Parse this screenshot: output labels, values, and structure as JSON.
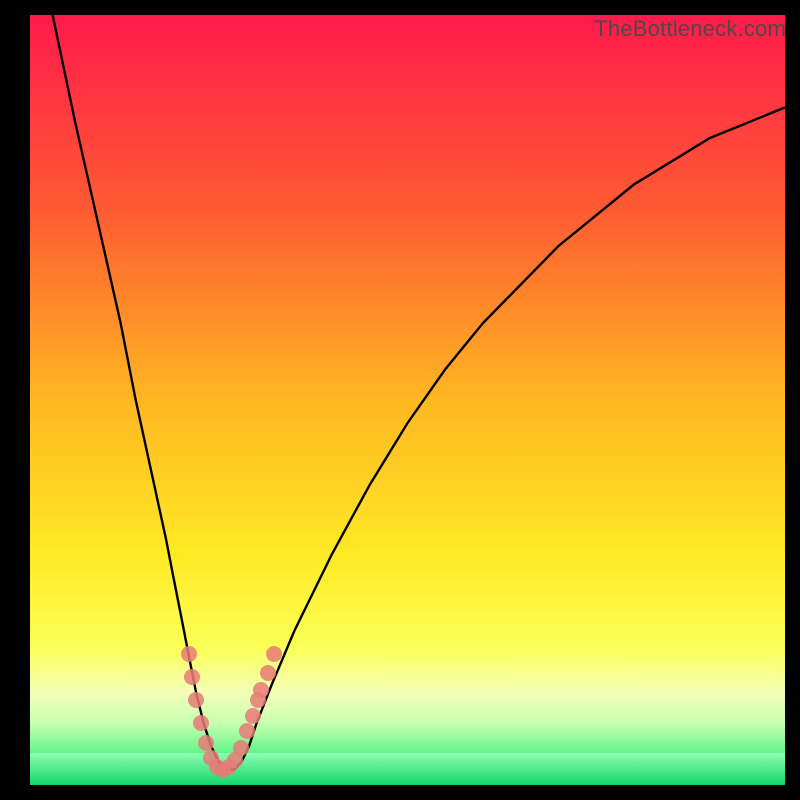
{
  "watermark": "TheBottleneck.com",
  "chart_data": {
    "type": "line",
    "title": "",
    "xlabel": "",
    "ylabel": "",
    "xlim": [
      0,
      100
    ],
    "ylim": [
      0,
      100
    ],
    "series": [
      {
        "name": "bottleneck-curve",
        "x": [
          3,
          6,
          9,
          12,
          14,
          16,
          18,
          19,
          20,
          21,
          22,
          23,
          24,
          25,
          26,
          27,
          28,
          29,
          30,
          32,
          35,
          40,
          45,
          50,
          55,
          60,
          65,
          70,
          75,
          80,
          85,
          90,
          95,
          100
        ],
        "y": [
          100,
          86,
          73,
          60,
          50,
          41,
          32,
          27,
          22,
          17,
          12,
          8,
          5,
          3,
          2,
          2,
          3,
          5,
          8,
          13,
          20,
          30,
          39,
          47,
          54,
          60,
          65,
          70,
          74,
          78,
          81,
          84,
          86,
          88
        ]
      }
    ],
    "markers": {
      "name": "highlight-points",
      "color": "#e77a78",
      "points": [
        {
          "x": 21.0,
          "y": 17
        },
        {
          "x": 21.5,
          "y": 14
        },
        {
          "x": 22.0,
          "y": 11
        },
        {
          "x": 22.7,
          "y": 8
        },
        {
          "x": 23.3,
          "y": 5.5
        },
        {
          "x": 24.0,
          "y": 3.5
        },
        {
          "x": 24.8,
          "y": 2.3
        },
        {
          "x": 25.6,
          "y": 2.0
        },
        {
          "x": 26.4,
          "y": 2.3
        },
        {
          "x": 27.2,
          "y": 3.3
        },
        {
          "x": 28.0,
          "y": 4.8
        },
        {
          "x": 28.8,
          "y": 7.0
        },
        {
          "x": 29.5,
          "y": 9.0
        },
        {
          "x": 30.2,
          "y": 11.0
        },
        {
          "x": 30.6,
          "y": 12.3
        },
        {
          "x": 31.5,
          "y": 14.5
        },
        {
          "x": 32.3,
          "y": 17.0
        }
      ]
    },
    "gradient": {
      "stops": [
        {
          "pos": 0,
          "color": "#ff1a4b"
        },
        {
          "pos": 25,
          "color": "#ff5a33"
        },
        {
          "pos": 50,
          "color": "#ffb722"
        },
        {
          "pos": 70,
          "color": "#ffe924"
        },
        {
          "pos": 82,
          "color": "#fbff55"
        },
        {
          "pos": 88,
          "color": "#f3ffb8"
        },
        {
          "pos": 92,
          "color": "#c7ffb0"
        },
        {
          "pos": 97,
          "color": "#45f17b"
        },
        {
          "pos": 100,
          "color": "#12d66a"
        }
      ]
    },
    "green_band_height_pct": 4.2
  }
}
